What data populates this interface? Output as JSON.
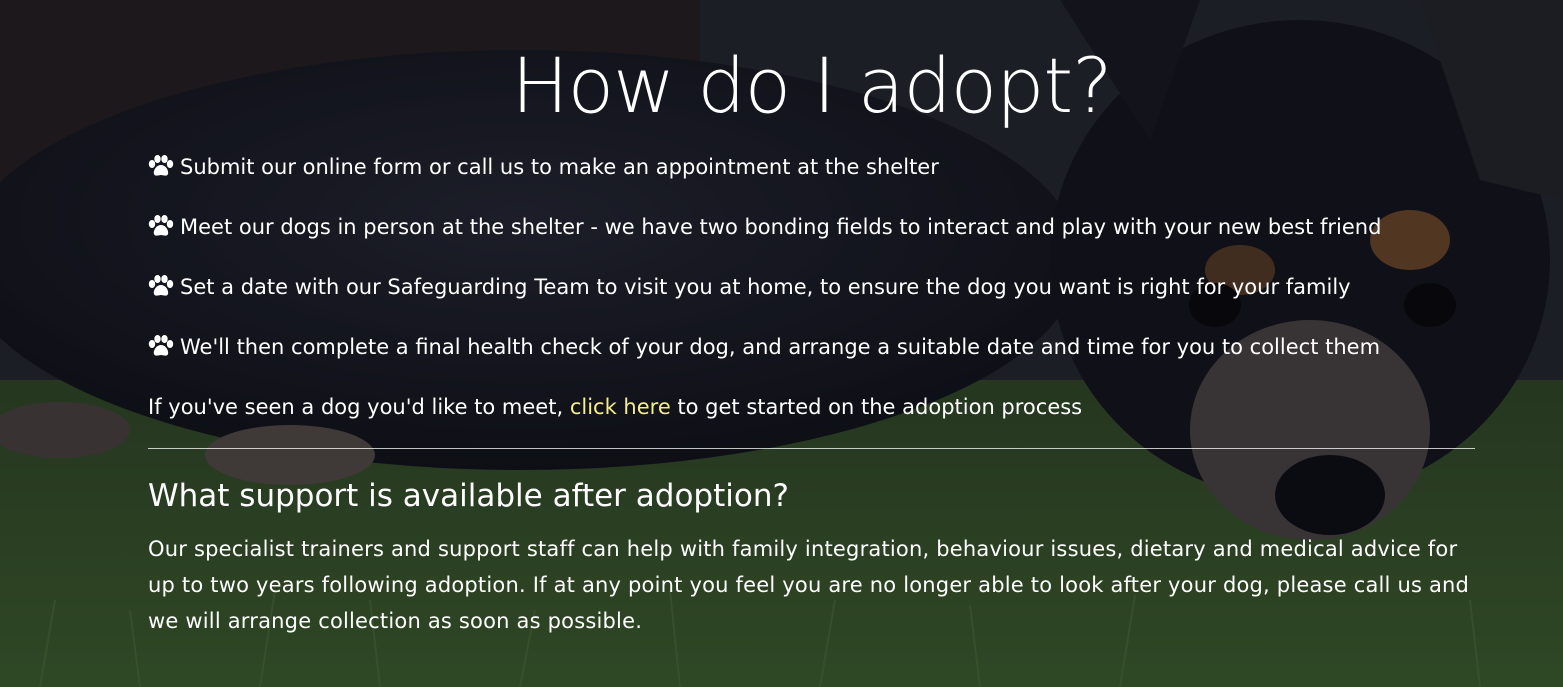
{
  "page": {
    "title": "How do I adopt?",
    "steps": [
      "Submit our online form or call us to make an appointment at the shelter",
      "Meet our dogs in person at the shelter - we have two bonding fields to interact and play with your new best friend",
      "Set a date with our Safeguarding Team to visit you at home, to ensure the dog you want is right for your family",
      "We'll then complete a final health check of your dog, and arrange a suitable date and time for you to collect them"
    ],
    "step_icon": "paw-icon",
    "cta": {
      "before": "If you've seen a dog you'd like to meet, ",
      "link": "click here",
      "after": " to get started on the adoption process"
    },
    "support": {
      "heading": "What support is available after adoption?",
      "body": "Our specialist trainers and support staff can help with family integration, behaviour issues, dietary and medical advice for up to two years following adoption. If at any point you feel you are no longer able to look after your dog, please call us and we will arrange collection as soon as possible."
    }
  },
  "colors": {
    "text": "#ffffff",
    "link": "#f4ee8c",
    "overlay": "#0a0c14"
  }
}
